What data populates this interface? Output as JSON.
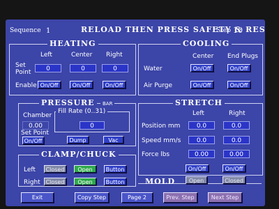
{
  "header": {
    "sequence_label": "Sequence",
    "sequence_value": "1",
    "title": "RELOAD THEN PRESS SAFETY & RESET",
    "step_label": "Step",
    "step_value": "10"
  },
  "heating": {
    "title": "HEATING",
    "col_left": "Left",
    "col_center": "Center",
    "col_right": "Right",
    "setpoint_label_1": "Set",
    "setpoint_label_2": "Point",
    "enable_label": "Enable",
    "setpoint_left": "0",
    "setpoint_center": "0",
    "setpoint_right": "0",
    "enable_left": "On/Off",
    "enable_center": "On/Off",
    "enable_right": "On/Off"
  },
  "cooling": {
    "title": "COOLING",
    "col_center": "Center",
    "col_endplugs": "End Plugs",
    "water_label": "Water",
    "airpurge_label": "Air Purge",
    "water_center": "On/Off",
    "water_endplugs": "On/Off",
    "air_center": "On/Off",
    "air_endplugs": "On/Off"
  },
  "pressure": {
    "title": "PRESSURE",
    "unit": "BAR",
    "chamber_label": "Chamber",
    "chamber_value": "0.00",
    "setpoint_label": "Set Point",
    "setpoint_toggle": "On/Off",
    "fillrate_label": "Fill Rate (0..31)",
    "fillrate_value": "0",
    "dump_label": "Dump",
    "vac_label": "Vac"
  },
  "stretch": {
    "title": "STRETCH",
    "col_left": "Left",
    "col_right": "Right",
    "position_label": "Position mm",
    "speed_label": "Speed mm/s",
    "force_label": "Force lbs",
    "position_left": "0.0",
    "position_right": "0.0",
    "speed_left": "0.0",
    "speed_right": "0.0",
    "force_left": "0.00",
    "force_right": "0.00",
    "toggle_left": "On/Off",
    "toggle_right": "On/Off"
  },
  "clamp": {
    "title": "CLAMP/CHUCK",
    "left_label": "Left",
    "right_label": "Right",
    "left_closed": "Closed",
    "left_open": "Open",
    "left_button": "Button",
    "right_closed": "Closed",
    "right_open": "Open",
    "right_button": "Button"
  },
  "mold": {
    "label": "MOLD",
    "open": "Open",
    "closed": "Closed"
  },
  "nav": {
    "exit": "Exit",
    "copy_step": "Copy Step",
    "page": "Page 2",
    "prev_step": "Prev. Step",
    "next_step": "Next Step"
  },
  "colors": {
    "screen_bg": "#3c45a8",
    "field_bg": "#2a35c8",
    "open_green": "#2ea84a",
    "disabled_gray": "#8088a8"
  }
}
